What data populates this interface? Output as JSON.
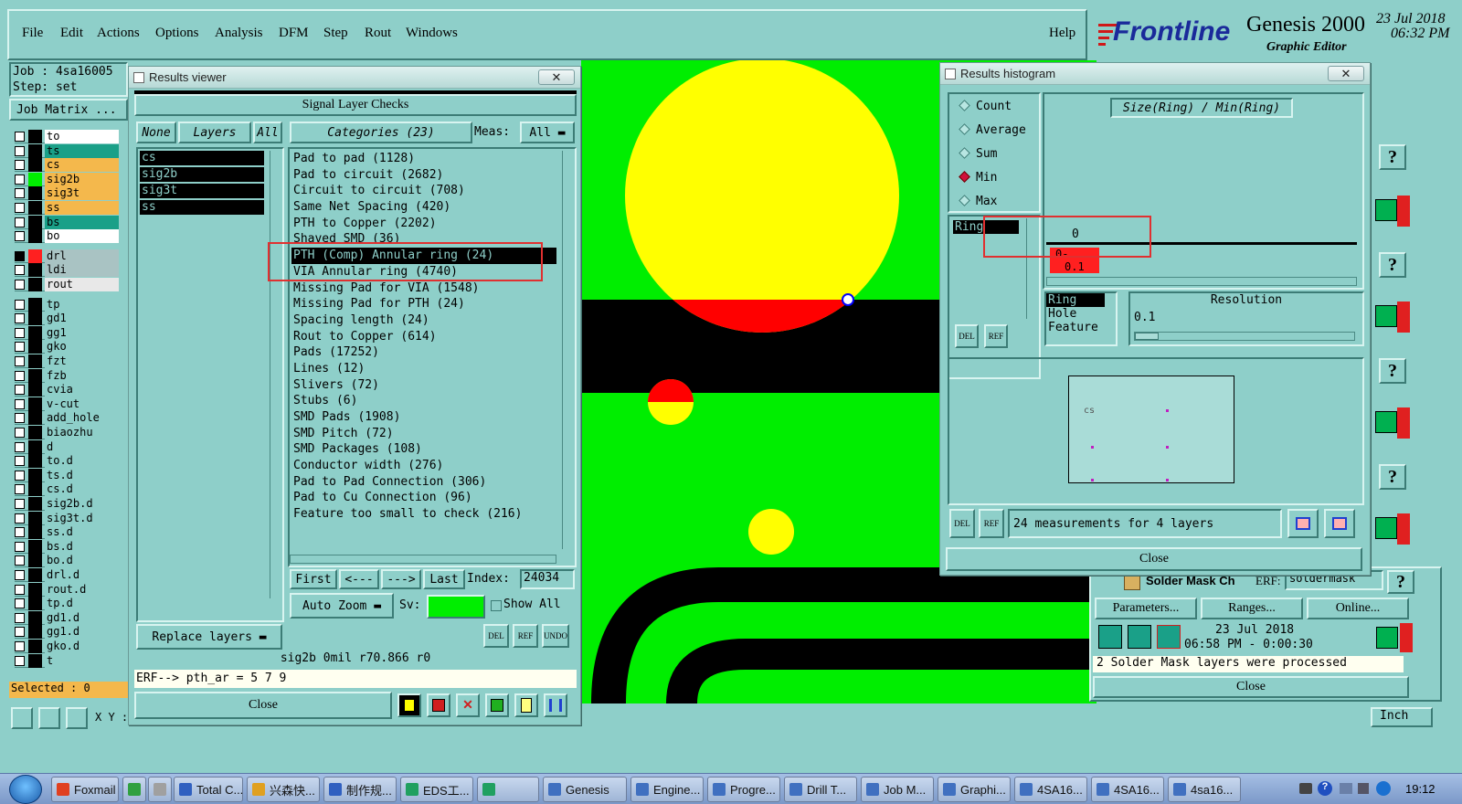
{
  "menu": [
    "File",
    "Edit",
    "Actions",
    "Options",
    "Analysis",
    "DFM",
    "Step",
    "Rout",
    "Windows"
  ],
  "help_label": "Help",
  "brand": {
    "logo": "Frontline",
    "product": "Genesis 2000",
    "subtitle": "Graphic Editor",
    "date": "23 Jul 2018",
    "time": "06:32 PM"
  },
  "job": {
    "job_label": "Job : 4sa16005",
    "step_label": "Step: set",
    "matrix_button": "Job Matrix ...",
    "selected_label": "Selected : 0"
  },
  "layers": [
    {
      "name": "to",
      "color": "#ffffff"
    },
    {
      "name": "ts",
      "color": "#1aa088"
    },
    {
      "name": "cs",
      "color": "#f4b84c"
    },
    {
      "name": "sig2b",
      "color": "#f4b84c",
      "active": true
    },
    {
      "name": "sig3t",
      "color": "#f4b84c"
    },
    {
      "name": "ss",
      "color": "#f4b84c"
    },
    {
      "name": "bs",
      "color": "#1aa088"
    },
    {
      "name": "bo",
      "color": "#ffffff"
    },
    {
      "name": "drl",
      "color": "#a9c3c3",
      "work": true
    },
    {
      "name": "ldi",
      "color": "#a9c3c3"
    },
    {
      "name": "rout",
      "color": "#e8e8e8"
    },
    {
      "name": "tp",
      "color": "#8ecfc9"
    },
    {
      "name": "gd1",
      "color": "#8ecfc9"
    },
    {
      "name": "gg1",
      "color": "#8ecfc9"
    },
    {
      "name": "gko",
      "color": "#8ecfc9"
    },
    {
      "name": "fzt",
      "color": "#8ecfc9"
    },
    {
      "name": "fzb",
      "color": "#8ecfc9"
    },
    {
      "name": "cvia",
      "color": "#8ecfc9"
    },
    {
      "name": "v-cut",
      "color": "#8ecfc9"
    },
    {
      "name": "add_hole",
      "color": "#8ecfc9"
    },
    {
      "name": "biaozhu",
      "color": "#8ecfc9"
    },
    {
      "name": "d",
      "color": "#8ecfc9"
    },
    {
      "name": "to.d",
      "color": "#8ecfc9"
    },
    {
      "name": "ts.d",
      "color": "#8ecfc9"
    },
    {
      "name": "cs.d",
      "color": "#8ecfc9"
    },
    {
      "name": "sig2b.d",
      "color": "#8ecfc9"
    },
    {
      "name": "sig3t.d",
      "color": "#8ecfc9"
    },
    {
      "name": "ss.d",
      "color": "#8ecfc9"
    },
    {
      "name": "bs.d",
      "color": "#8ecfc9"
    },
    {
      "name": "bo.d",
      "color": "#8ecfc9"
    },
    {
      "name": "drl.d",
      "color": "#8ecfc9"
    },
    {
      "name": "rout.d",
      "color": "#8ecfc9"
    },
    {
      "name": "tp.d",
      "color": "#8ecfc9"
    },
    {
      "name": "gd1.d",
      "color": "#8ecfc9"
    },
    {
      "name": "gg1.d",
      "color": "#8ecfc9"
    },
    {
      "name": "gko.d",
      "color": "#8ecfc9"
    },
    {
      "name": "t",
      "color": "#8ecfc9"
    }
  ],
  "results_viewer": {
    "title": "Results viewer",
    "section_title": "Signal Layer Checks",
    "none_label": "None",
    "layers_label": "Layers",
    "all_label": "All",
    "layers": [
      "cs",
      "sig2b",
      "sig3t",
      "ss"
    ],
    "categories_label": "Categories (23)",
    "meas_label": "Meas:",
    "meas_value": "All",
    "categories": [
      "Pad to pad (1128)",
      "Pad to circuit (2682)",
      "Circuit to circuit (708)",
      "Same Net Spacing (420)",
      "PTH to Copper (2202)",
      "Shaved SMD (36)",
      "PTH (Comp) Annular ring (24)",
      "VIA Annular ring (4740)",
      "Missing Pad for VIA (1548)",
      "Missing Pad for PTH (24)",
      "Spacing length (24)",
      "Rout to Copper (614)",
      "Pads (17252)",
      "Lines (12)",
      "Slivers (72)",
      "Stubs (6)",
      "SMD Pads (1908)",
      "SMD Pitch (72)",
      "SMD Packages (108)",
      "Conductor width (276)",
      "Pad to Pad Connection (306)",
      "Pad to Cu Connection (96)",
      "Feature too small to check (216)"
    ],
    "selected_category": 6,
    "nav": {
      "first": "First",
      "prev": "<---",
      "next": "--->",
      "last": "Last",
      "index_label": "Index:",
      "index_value": "24034"
    },
    "auto_zoom": "Auto Zoom",
    "sv_label": "Sv:",
    "show_all": "Show All",
    "replace_layers": "Replace layers",
    "del": "DEL",
    "ref": "REF",
    "undo": "UNDO",
    "status": "sig2b 0mil  r70.866  r0",
    "erf_line": "ERF--> pth_ar = 5 7 9",
    "close": "Close"
  },
  "histogram": {
    "title": "Results histogram",
    "modes": [
      "Count",
      "Average",
      "Sum",
      "Min",
      "Max"
    ],
    "selected_mode": "Min",
    "chart_title": "Size(Ring) / Min(Ring)",
    "attr_list": [
      "Ring"
    ],
    "bar_label_top": "0",
    "bar_label_mid": "0-",
    "bar_label_bottom": "0.1",
    "params": [
      "Ring",
      "Hole",
      "Feature"
    ],
    "resolution_label": "Resolution",
    "resolution_value": "0.1",
    "preview_label": "cs",
    "summary": "24 measurements for 4 layers",
    "del": "DEL",
    "ref": "REF",
    "close": "Close"
  },
  "solder_panel": {
    "row_label": "Solder Mask Ch",
    "erf_label": "ERF:",
    "erf_value": "soldermask",
    "buttons": [
      "Parameters...",
      "Ranges...",
      "Online..."
    ],
    "date": "23 Jul 2018",
    "time_line": "06:58 PM - 0:00:30",
    "message": "2 Solder Mask layers were processed",
    "close": "Close"
  },
  "status_bar": {
    "xy_label": "X Y :",
    "units": "Inch"
  },
  "taskbar": {
    "items": [
      "Foxmail",
      "",
      "",
      "Total C...",
      "兴森快...",
      "制作规...",
      "EDS工...",
      "",
      "Genesis",
      "Engine...",
      "Progre...",
      "Drill T...",
      "Job M...",
      "Graphi...",
      "4SA16...",
      "4SA16...",
      "4sa16..."
    ],
    "clock": "19:12"
  },
  "colors": {
    "board": "#00ee00",
    "copper": "#000000",
    "pad": "#ffff00",
    "violation": "#ff0000",
    "ui_face": "#8ecfc9"
  }
}
